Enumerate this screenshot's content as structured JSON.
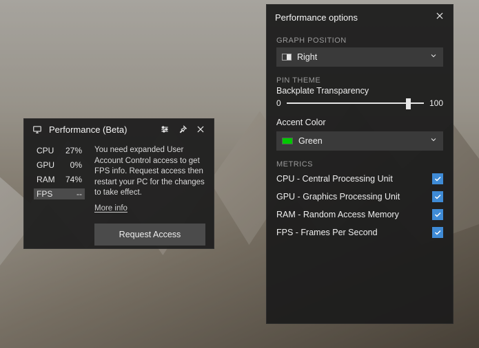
{
  "perf": {
    "title": "Performance (Beta)",
    "stats": [
      {
        "label": "CPU",
        "value": "27%",
        "selected": false
      },
      {
        "label": "GPU",
        "value": "0%",
        "selected": false
      },
      {
        "label": "RAM",
        "value": "74%",
        "selected": false
      },
      {
        "label": "FPS",
        "value": "--",
        "selected": true
      }
    ],
    "message": "You need expanded User Account Control access to get FPS info. Request access then restart your PC for the changes to take effect.",
    "more_info": "More info",
    "request_button": "Request Access"
  },
  "options": {
    "title": "Performance options",
    "graph_position": {
      "label": "GRAPH POSITION",
      "value": "Right"
    },
    "pin_theme": {
      "label": "PIN THEME",
      "backplate_label": "Backplate Transparency",
      "min": "0",
      "max": "100",
      "value_pct": 87
    },
    "accent": {
      "label": "Accent Color",
      "value": "Green",
      "color": "#00c800"
    },
    "metrics": {
      "label": "METRICS",
      "items": [
        {
          "label": "CPU - Central Processing Unit",
          "checked": true
        },
        {
          "label": "GPU - Graphics Processing Unit",
          "checked": true
        },
        {
          "label": "RAM - Random Access Memory",
          "checked": true
        },
        {
          "label": "FPS - Frames Per Second",
          "checked": true
        }
      ]
    }
  }
}
